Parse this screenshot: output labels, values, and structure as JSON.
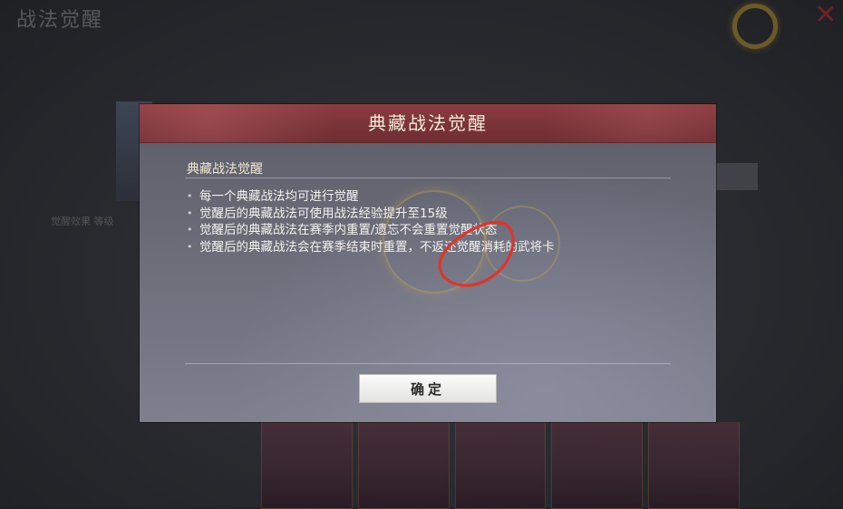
{
  "background": {
    "screen_title": "战法觉醒",
    "close_glyph": "✕",
    "side_text": "觉醒效果  等级",
    "card_count": 5
  },
  "dialog": {
    "title": "典藏战法觉醒",
    "section_title": "典藏战法觉醒",
    "bullet_glyph": "•",
    "rules": [
      "每一个典藏战法均可进行觉醒",
      "觉醒后的典藏战法可使用战法经验提升至15级",
      "觉醒后的典藏战法在赛季内重置/遗忘不会重置觉醒状态",
      "觉醒后的典藏战法会在赛季结束时重置，不返还觉醒消耗的武将卡"
    ],
    "confirm_label": "确定"
  },
  "annotation": {
    "shape": "hand-drawn circle",
    "color": "#e0342a"
  }
}
